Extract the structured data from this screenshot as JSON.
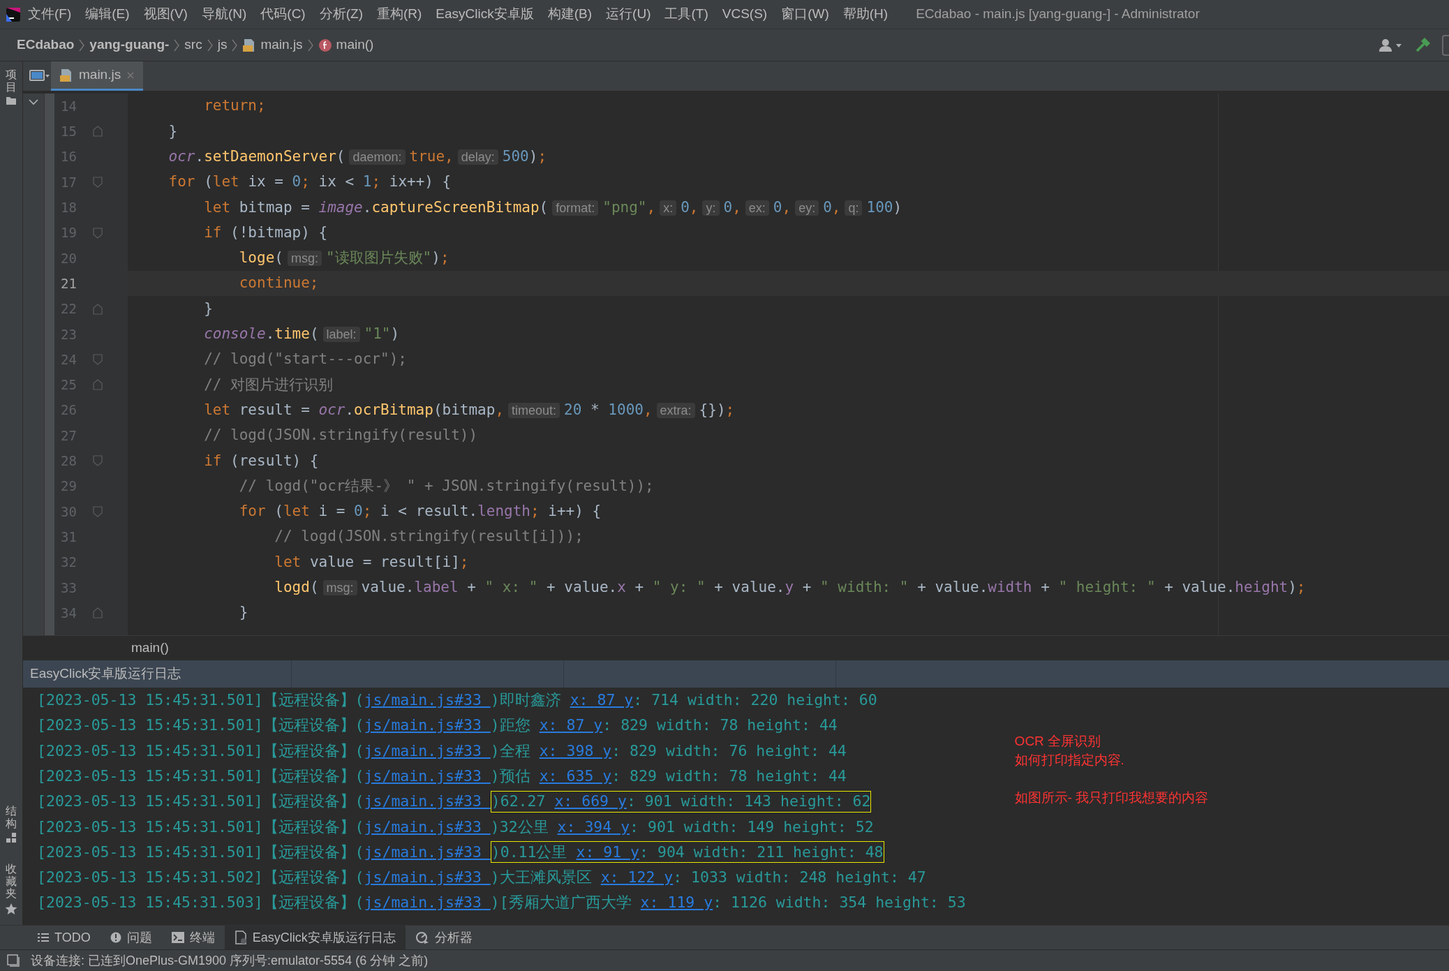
{
  "menu": {
    "items": [
      "文件(F)",
      "编辑(E)",
      "视图(V)",
      "导航(N)",
      "代码(C)",
      "分析(Z)",
      "重构(R)",
      "EasyClick安卓版",
      "构建(B)",
      "运行(U)",
      "工具(T)",
      "VCS(S)",
      "窗口(W)",
      "帮助(H)"
    ],
    "title": "ECdabao - main.js [yang-guang-] - Administrator"
  },
  "breadcrumb": [
    {
      "label": "ECdabao",
      "kind": "project"
    },
    {
      "label": "yang-guang-",
      "kind": "project"
    },
    {
      "label": "src",
      "kind": "folder"
    },
    {
      "label": "js",
      "kind": "folder"
    },
    {
      "label": "main.js",
      "kind": "file"
    },
    {
      "label": "main()",
      "kind": "function"
    }
  ],
  "side_tabs": {
    "top": [
      "项目"
    ],
    "bottom": [
      "结构",
      "收藏夹"
    ]
  },
  "editor_tabs": [
    {
      "label": "main.js",
      "selected": true
    }
  ],
  "code": [
    {
      "number": "14",
      "current": false,
      "kind": "plain",
      "tokens": [
        {
          "kind": "kw",
          "text": "        return;"
        }
      ]
    },
    {
      "number": "15",
      "current": false,
      "kind": "fold_end",
      "tokens": [
        {
          "kind": "p",
          "text": "    }"
        }
      ]
    },
    {
      "number": "16",
      "current": false,
      "kind": "plain",
      "tokens": [
        {
          "kind": "obj",
          "text": "    ocr"
        },
        {
          "kind": "p",
          "text": "."
        },
        {
          "kind": "fn",
          "text": "setDaemonServer"
        },
        {
          "kind": "p",
          "text": "("
        },
        {
          "kind": "hint",
          "text": "daemon:"
        },
        {
          "kind": "kw",
          "text": "true,"
        },
        {
          "kind": "hint",
          "text": "delay:"
        },
        {
          "kind": "num",
          "text": "500"
        },
        {
          "kind": "p",
          "text": ")"
        },
        {
          "kind": "kw",
          "text": ";"
        }
      ]
    },
    {
      "number": "17",
      "current": false,
      "kind": "fold_start",
      "tokens": [
        {
          "kind": "kw",
          "text": "    for "
        },
        {
          "kind": "p",
          "text": "("
        },
        {
          "kind": "kw",
          "text": "let "
        },
        {
          "kind": "p",
          "text": "ix = "
        },
        {
          "kind": "num",
          "text": "0"
        },
        {
          "kind": "kw",
          "text": "; "
        },
        {
          "kind": "p",
          "text": "ix < "
        },
        {
          "kind": "num",
          "text": "1"
        },
        {
          "kind": "kw",
          "text": "; "
        },
        {
          "kind": "p",
          "text": "ix++) {"
        }
      ]
    },
    {
      "number": "18",
      "current": false,
      "kind": "plain",
      "tokens": [
        {
          "kind": "kw",
          "text": "        let "
        },
        {
          "kind": "p",
          "text": "bitmap = "
        },
        {
          "kind": "obj",
          "text": "image"
        },
        {
          "kind": "p",
          "text": "."
        },
        {
          "kind": "fn",
          "text": "captureScreenBitmap"
        },
        {
          "kind": "p",
          "text": "("
        },
        {
          "kind": "hint",
          "text": "format:"
        },
        {
          "kind": "str",
          "text": "\"png\""
        },
        {
          "kind": "kw",
          "text": ","
        },
        {
          "kind": "hint",
          "text": "x:"
        },
        {
          "kind": "num",
          "text": "0"
        },
        {
          "kind": "kw",
          "text": ","
        },
        {
          "kind": "hint",
          "text": "y:"
        },
        {
          "kind": "num",
          "text": "0"
        },
        {
          "kind": "kw",
          "text": ","
        },
        {
          "kind": "hint",
          "text": "ex:"
        },
        {
          "kind": "num",
          "text": "0"
        },
        {
          "kind": "kw",
          "text": ","
        },
        {
          "kind": "hint",
          "text": "ey:"
        },
        {
          "kind": "num",
          "text": "0"
        },
        {
          "kind": "kw",
          "text": ","
        },
        {
          "kind": "hint",
          "text": "q:"
        },
        {
          "kind": "num",
          "text": "100"
        },
        {
          "kind": "p",
          "text": ")"
        }
      ]
    },
    {
      "number": "19",
      "current": false,
      "kind": "fold_start",
      "tokens": [
        {
          "kind": "kw",
          "text": "        if "
        },
        {
          "kind": "p",
          "text": "(!bitmap) {"
        }
      ]
    },
    {
      "number": "20",
      "current": false,
      "kind": "plain",
      "tokens": [
        {
          "kind": "fn",
          "text": "            loge"
        },
        {
          "kind": "p",
          "text": "("
        },
        {
          "kind": "hint",
          "text": "msg:"
        },
        {
          "kind": "str",
          "text": "\"读取图片失败\""
        },
        {
          "kind": "p",
          "text": ")"
        },
        {
          "kind": "kw",
          "text": ";"
        }
      ]
    },
    {
      "number": "21",
      "current": true,
      "kind": "plain",
      "tokens": [
        {
          "kind": "kw",
          "text": "            continue;"
        }
      ]
    },
    {
      "number": "22",
      "current": false,
      "kind": "fold_end",
      "tokens": [
        {
          "kind": "p",
          "text": "        }"
        }
      ]
    },
    {
      "number": "23",
      "current": false,
      "kind": "plain",
      "tokens": [
        {
          "kind": "obj",
          "text": "        console"
        },
        {
          "kind": "p",
          "text": "."
        },
        {
          "kind": "fn",
          "text": "time"
        },
        {
          "kind": "p",
          "text": "("
        },
        {
          "kind": "hint",
          "text": "label:"
        },
        {
          "kind": "str",
          "text": "\"1\""
        },
        {
          "kind": "p",
          "text": ")"
        }
      ]
    },
    {
      "number": "24",
      "current": false,
      "kind": "fold_start",
      "tokens": [
        {
          "kind": "cm",
          "text": "        // logd(\"start---ocr\");"
        }
      ]
    },
    {
      "number": "25",
      "current": false,
      "kind": "fold_end",
      "tokens": [
        {
          "kind": "cm",
          "text": "        // 对图片进行识别"
        }
      ]
    },
    {
      "number": "26",
      "current": false,
      "kind": "plain",
      "tokens": [
        {
          "kind": "kw",
          "text": "        let "
        },
        {
          "kind": "p",
          "text": "result = "
        },
        {
          "kind": "obj",
          "text": "ocr"
        },
        {
          "kind": "p",
          "text": "."
        },
        {
          "kind": "fn",
          "text": "ocrBitmap"
        },
        {
          "kind": "p",
          "text": "(bitmap"
        },
        {
          "kind": "kw",
          "text": ","
        },
        {
          "kind": "hint",
          "text": "timeout:"
        },
        {
          "kind": "num",
          "text": "20"
        },
        {
          "kind": "p",
          "text": " * "
        },
        {
          "kind": "num",
          "text": "1000"
        },
        {
          "kind": "kw",
          "text": ","
        },
        {
          "kind": "hint",
          "text": "extra:"
        },
        {
          "kind": "p",
          "text": "{})"
        },
        {
          "kind": "kw",
          "text": ";"
        }
      ]
    },
    {
      "number": "27",
      "current": false,
      "kind": "plain",
      "tokens": [
        {
          "kind": "cm",
          "text": "        // logd(JSON.stringify(result))"
        }
      ]
    },
    {
      "number": "28",
      "current": false,
      "kind": "fold_start",
      "tokens": [
        {
          "kind": "kw",
          "text": "        if "
        },
        {
          "kind": "p",
          "text": "(result) {"
        }
      ]
    },
    {
      "number": "29",
      "current": false,
      "kind": "plain",
      "tokens": [
        {
          "kind": "cm",
          "text": "            // logd(\"ocr结果-》 \" + JSON.stringify(result));"
        }
      ]
    },
    {
      "number": "30",
      "current": false,
      "kind": "fold_start",
      "tokens": [
        {
          "kind": "kw",
          "text": "            for "
        },
        {
          "kind": "p",
          "text": "("
        },
        {
          "kind": "kw",
          "text": "let "
        },
        {
          "kind": "p",
          "text": "i = "
        },
        {
          "kind": "num",
          "text": "0"
        },
        {
          "kind": "kw",
          "text": "; "
        },
        {
          "kind": "p",
          "text": "i < result."
        },
        {
          "kind": "prop",
          "text": "length"
        },
        {
          "kind": "kw",
          "text": "; "
        },
        {
          "kind": "p",
          "text": "i++) {"
        }
      ]
    },
    {
      "number": "31",
      "current": false,
      "kind": "plain",
      "tokens": [
        {
          "kind": "cm",
          "text": "                // logd(JSON.stringify(result[i]));"
        }
      ]
    },
    {
      "number": "32",
      "current": false,
      "kind": "plain",
      "tokens": [
        {
          "kind": "kw",
          "text": "                let "
        },
        {
          "kind": "p",
          "text": "value = result[i]"
        },
        {
          "kind": "kw",
          "text": ";"
        }
      ]
    },
    {
      "number": "33",
      "current": false,
      "kind": "plain",
      "tokens": [
        {
          "kind": "fn",
          "text": "                logd"
        },
        {
          "kind": "p",
          "text": "("
        },
        {
          "kind": "hint",
          "text": "msg:"
        },
        {
          "kind": "p",
          "text": "value."
        },
        {
          "kind": "prop",
          "text": "label"
        },
        {
          "kind": "p",
          "text": " + "
        },
        {
          "kind": "str",
          "text": "\" x: \""
        },
        {
          "kind": "p",
          "text": " + value."
        },
        {
          "kind": "prop",
          "text": "x"
        },
        {
          "kind": "p",
          "text": " + "
        },
        {
          "kind": "str",
          "text": "\" y: \""
        },
        {
          "kind": "p",
          "text": " + value."
        },
        {
          "kind": "prop",
          "text": "y"
        },
        {
          "kind": "p",
          "text": " + "
        },
        {
          "kind": "str",
          "text": "\" width: \""
        },
        {
          "kind": "p",
          "text": " + value."
        },
        {
          "kind": "prop",
          "text": "width"
        },
        {
          "kind": "p",
          "text": " + "
        },
        {
          "kind": "str",
          "text": "\" height: \""
        },
        {
          "kind": "p",
          "text": " + value."
        },
        {
          "kind": "prop",
          "text": "height"
        },
        {
          "kind": "p",
          "text": ")"
        },
        {
          "kind": "kw",
          "text": ";"
        }
      ]
    },
    {
      "number": "34",
      "current": false,
      "kind": "fold_end",
      "tokens": [
        {
          "kind": "p",
          "text": "            }"
        }
      ]
    }
  ],
  "function_breadcrumb": "main()",
  "log_panel": {
    "title": "EasyClick安卓版运行日志",
    "lines": [
      {
        "prefix": "[2023-05-13 15:45:31.501]【远程设备】(",
        "link": "js/main.js#33 ",
        "label": ")即时鑫济 ",
        "coords": "x: 87 y",
        "rest": ": 714 width: 220 height: 60",
        "highlighted": false
      },
      {
        "prefix": "[2023-05-13 15:45:31.501]【远程设备】(",
        "link": "js/main.js#33 ",
        "label": ")距您 ",
        "coords": "x: 87 y",
        "rest": ": 829 width: 78 height: 44",
        "highlighted": false
      },
      {
        "prefix": "[2023-05-13 15:45:31.501]【远程设备】(",
        "link": "js/main.js#33 ",
        "label": ")全程 ",
        "coords": "x: 398 y",
        "rest": ": 829 width: 76 height: 44",
        "highlighted": false
      },
      {
        "prefix": "[2023-05-13 15:45:31.501]【远程设备】(",
        "link": "js/main.js#33 ",
        "label": ")预估 ",
        "coords": "x: 635 y",
        "rest": ": 829 width: 78 height: 44",
        "highlighted": false
      },
      {
        "prefix": "[2023-05-13 15:45:31.501]【远程设备】(",
        "link": "js/main.js#33 ",
        "label": ")62.27 ",
        "coords": "x: 669 y",
        "rest": ": 901 width: 143 height: 62",
        "highlighted": true
      },
      {
        "prefix": "[2023-05-13 15:45:31.501]【远程设备】(",
        "link": "js/main.js#33 ",
        "label": ")32公里 ",
        "coords": "x: 394 y",
        "rest": ": 901 width: 149 height: 52",
        "highlighted": false
      },
      {
        "prefix": "[2023-05-13 15:45:31.501]【远程设备】(",
        "link": "js/main.js#33 ",
        "label": ")0.11公里 ",
        "coords": "x: 91 y",
        "rest": ": 904 width: 211 height: 48",
        "highlighted": true
      },
      {
        "prefix": "[2023-05-13 15:45:31.502]【远程设备】(",
        "link": "js/main.js#33 ",
        "label": ")大王滩风景区 ",
        "coords": "x: 122 y",
        "rest": ": 1033 width: 248 height: 47",
        "highlighted": false
      },
      {
        "prefix": "[2023-05-13 15:45:31.503]【远程设备】(",
        "link": "js/main.js#33 ",
        "label": ")[秀厢大道广西大学 ",
        "coords": "x: 119 y",
        "rest": ": 1126 width: 354 height: 53",
        "highlighted": false
      }
    ],
    "annotation": [
      "OCR 全屏识别",
      "如何打印指定内容.",
      "如图所示- 我只打印我想要的内容"
    ]
  },
  "tool_tabs": [
    {
      "label": "TODO",
      "kind": "list",
      "selected": false
    },
    {
      "label": "问题",
      "kind": "problems",
      "selected": false
    },
    {
      "label": "终端",
      "kind": "terminal",
      "selected": false
    },
    {
      "label": "EasyClick安卓版运行日志",
      "kind": "log",
      "selected": true
    },
    {
      "label": "分析器",
      "kind": "profiler",
      "selected": false
    }
  ],
  "status_bar": "设备连接: 已连到OnePlus-GM1900 序列号:emulator-5554 (6 分钟 之前)"
}
